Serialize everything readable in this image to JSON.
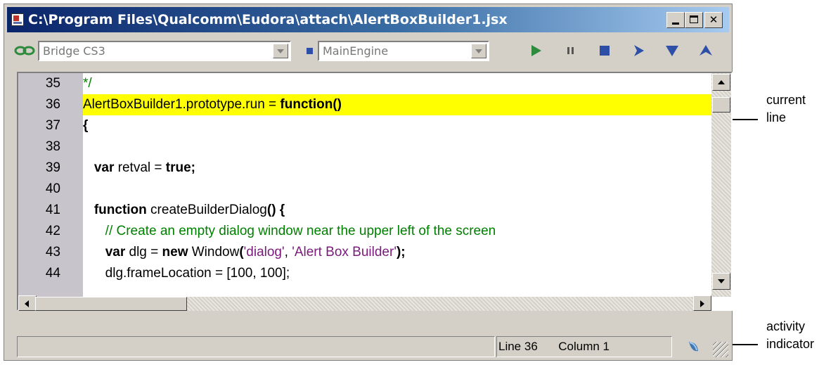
{
  "window": {
    "title": "C:\\Program Files\\Qualcomm\\Eudora\\attach\\AlertBoxBuilder1.jsx",
    "minimize_icon": "minimize-icon",
    "maximize_icon": "maximize-icon",
    "close_icon": "close-icon"
  },
  "toolbar": {
    "target_app": "Bridge CS3",
    "engine": "MainEngine",
    "buttons": [
      "run-icon",
      "pause-icon",
      "stop-icon",
      "step-over-icon",
      "step-into-icon",
      "step-out-icon"
    ],
    "colors": {
      "run": "#2e8b3e",
      "buttons": "#2d4fa8"
    }
  },
  "editor": {
    "current_line_color": "#ffff00",
    "line_numbers": [
      "35",
      "36",
      "37",
      "38",
      "39",
      "40",
      "41",
      "42",
      "43",
      "44"
    ]
  },
  "status": {
    "line": "Line 36",
    "column": "Column 1"
  },
  "callouts": {
    "current_line": [
      "current",
      "line"
    ],
    "activity_indicator": [
      "activity",
      "indicator"
    ]
  }
}
